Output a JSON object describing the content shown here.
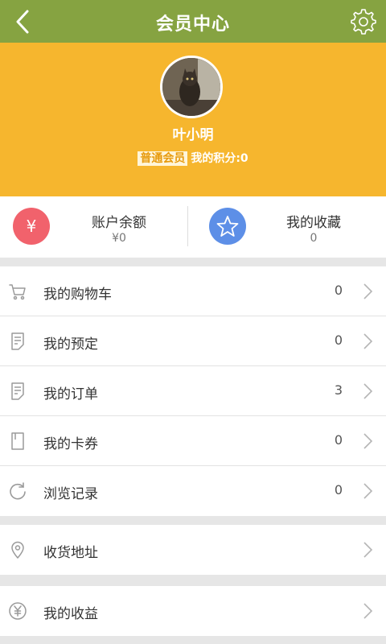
{
  "header": {
    "title": "会员中心",
    "back_icon": "chevron-left-icon",
    "settings_icon": "gear-icon"
  },
  "profile": {
    "username": "叶小明",
    "level_badge": "普通会员",
    "points_text": "我的积分:0"
  },
  "stats": {
    "balance": {
      "label": "账户余额",
      "value": "¥0",
      "icon_text": "¥"
    },
    "favorites": {
      "label": "我的收藏",
      "value": "0",
      "icon": "star-icon"
    }
  },
  "menu": [
    {
      "label": "我的购物车",
      "count": "0",
      "icon": "cart-icon"
    },
    {
      "label": "我的预定",
      "count": "0",
      "icon": "document-icon"
    },
    {
      "label": "我的订单",
      "count": "3",
      "icon": "document-icon"
    },
    {
      "label": "我的卡券",
      "count": "0",
      "icon": "card-icon"
    },
    {
      "label": "浏览记录",
      "count": "0",
      "icon": "refresh-icon"
    }
  ],
  "address": {
    "label": "收货地址",
    "icon": "location-icon"
  },
  "earnings": {
    "label": "我的收益",
    "icon": "yen-circle-icon"
  },
  "colors": {
    "topbar": "#86a341",
    "profile_bg": "#f6b62e",
    "balance_icon": "#f1626c",
    "favorites_icon": "#5d8fe7"
  }
}
